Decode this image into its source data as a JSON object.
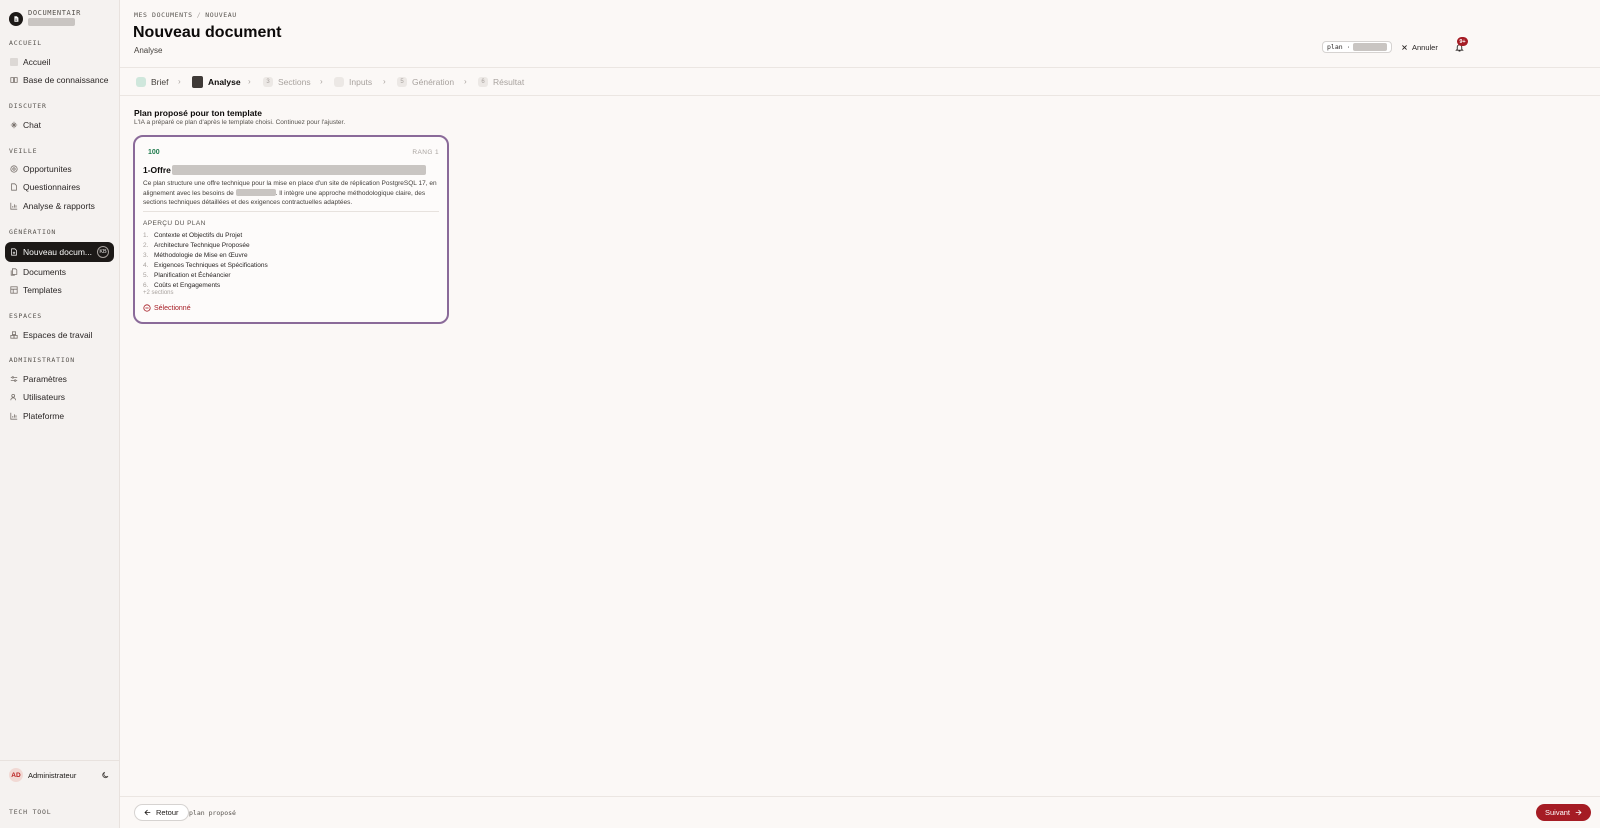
{
  "sidebar": {
    "brand_name": "DOCUMENTAIR",
    "sections": {
      "accueil": "ACCUEIL",
      "discuter": "DISCUTER",
      "veille": "VEILLE",
      "generation": "GÉNÉRATION",
      "espaces": "ESPACES",
      "administration": "ADMINISTRATION"
    },
    "items": {
      "accueil": "Accueil",
      "base": "Base de connaissance",
      "chat": "Chat",
      "opportunites": "Opportunites",
      "questionnaires": "Questionnaires",
      "analyse": "Analyse & rapports",
      "nouveau": "Nouveau docum...",
      "nouveau_badge": "KB",
      "documents": "Documents",
      "templates": "Templates",
      "espaces_travail": "Espaces de travail",
      "parametres": "Paramètres",
      "utilisateurs": "Utilisateurs",
      "plateforme": "Plateforme"
    },
    "user": {
      "initials": "AD",
      "name": "Administrateur"
    },
    "footer_label": "TECH TOOL"
  },
  "header": {
    "breadcrumb": [
      "MES DOCUMENTS",
      "NOUVEAU"
    ],
    "title": "Nouveau document",
    "subtitle": "Analyse",
    "plan_pill": "plan ·",
    "cancel_label": "Annuler",
    "notif_count": "9+"
  },
  "stepper": [
    {
      "num": "",
      "label": "Brief",
      "state": "done"
    },
    {
      "num": "",
      "label": "Analyse",
      "state": "current"
    },
    {
      "num": "3",
      "label": "Sections",
      "state": "pending"
    },
    {
      "num": "",
      "label": "Inputs",
      "state": "pending"
    },
    {
      "num": "5",
      "label": "Génération",
      "state": "pending"
    },
    {
      "num": "6",
      "label": "Résultat",
      "state": "pending"
    }
  ],
  "main": {
    "title": "Plan proposé pour ton template",
    "description": "L'IA a préparé ce plan d'après le template choisi. Continuez pour l'ajuster."
  },
  "card": {
    "score": "100",
    "rank": "RANG 1",
    "title": "1-Offre",
    "description_part1": "Ce plan structure une offre technique pour la mise en place d'un site de réplication PostgreSQL 17, en alignement avec les besoins de",
    "description_part2": ". Il intègre une approche méthodologique claire, des sections techniques détaillées et des exigences contractuelles adaptées.",
    "apercu_label": "APERÇU DU PLAN",
    "plan_items": [
      {
        "n": "1.",
        "label": "Contexte et Objectifs du Projet"
      },
      {
        "n": "2.",
        "label": "Architecture Technique Proposée"
      },
      {
        "n": "3.",
        "label": "Méthodologie de Mise en Œuvre"
      },
      {
        "n": "4.",
        "label": "Exigences Techniques et Spécifications"
      },
      {
        "n": "5.",
        "label": "Planification et Échéancier"
      },
      {
        "n": "6.",
        "label": "Coûts et Engagements"
      }
    ],
    "more": "+2 sections",
    "selected_label": "Sélectionné"
  },
  "footer": {
    "back_label": "Retour",
    "status": "plan proposé",
    "next_label": "Suivant"
  },
  "colors": {
    "accent": "#a51c24",
    "card_border": "#8a6a99",
    "score": "#1f7a4c",
    "active_nav": "#1c1917"
  }
}
